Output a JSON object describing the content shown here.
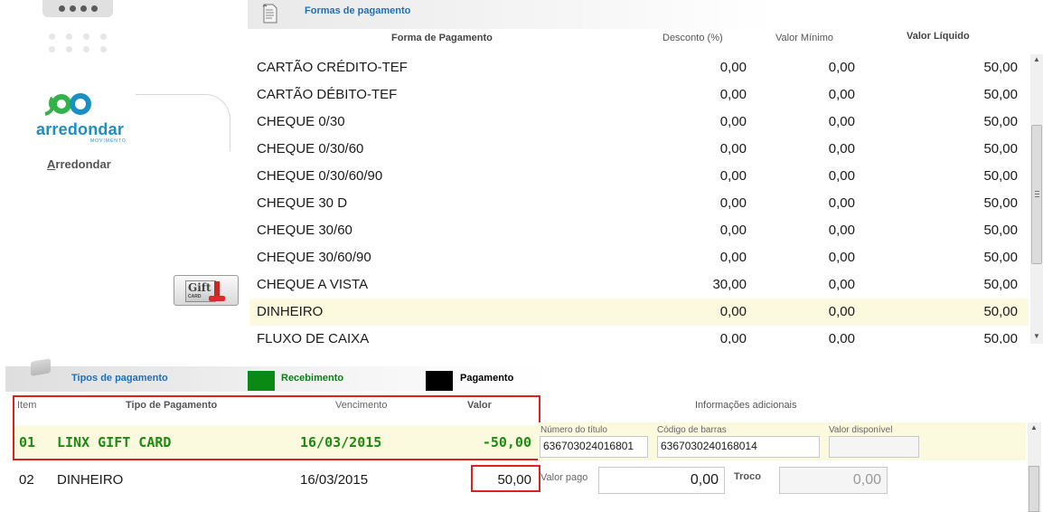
{
  "sidebar": {
    "logo_text": "arredondar",
    "logo_subtext": "MOVIMENTO",
    "arredondar_label_first": "A",
    "arredondar_label_rest": "rredondar",
    "gift_card_text": "Gift",
    "gift_card_subtext": "CARD"
  },
  "formas": {
    "title": "Formas de pagamento",
    "headers": {
      "forma": "Forma de Pagamento",
      "desconto": "Desconto (%)",
      "valor_minimo": "Valor Mínimo",
      "valor_liquido": "Valor Líquido"
    },
    "rows": [
      {
        "name": "CARTÃO CRÉDITO-TEF",
        "desconto": "0,00",
        "minimo": "0,00",
        "liquido": "50,00"
      },
      {
        "name": "CARTÃO DÉBITO-TEF",
        "desconto": "0,00",
        "minimo": "0,00",
        "liquido": "50,00"
      },
      {
        "name": "CHEQUE 0/30",
        "desconto": "0,00",
        "minimo": "0,00",
        "liquido": "50,00"
      },
      {
        "name": "CHEQUE 0/30/60",
        "desconto": "0,00",
        "minimo": "0,00",
        "liquido": "50,00"
      },
      {
        "name": "CHEQUE 0/30/60/90",
        "desconto": "0,00",
        "minimo": "0,00",
        "liquido": "50,00"
      },
      {
        "name": "CHEQUE 30 D",
        "desconto": "0,00",
        "minimo": "0,00",
        "liquido": "50,00"
      },
      {
        "name": "CHEQUE 30/60",
        "desconto": "0,00",
        "minimo": "0,00",
        "liquido": "50,00"
      },
      {
        "name": "CHEQUE 30/60/90",
        "desconto": "0,00",
        "minimo": "0,00",
        "liquido": "50,00"
      },
      {
        "name": "CHEQUE A VISTA",
        "desconto": "30,00",
        "minimo": "0,00",
        "liquido": "50,00"
      },
      {
        "name": "DINHEIRO",
        "desconto": "0,00",
        "minimo": "0,00",
        "liquido": "50,00"
      },
      {
        "name": "FLUXO DE CAIXA",
        "desconto": "0,00",
        "minimo": "0,00",
        "liquido": "50,00"
      }
    ]
  },
  "tabs": {
    "tipos": "Tipos de pagamento",
    "recebimento": "Recebimento",
    "pagamento": "Pagamento"
  },
  "items": {
    "headers": {
      "item": "Item",
      "tipo": "Tipo de Pagamento",
      "vencimento": "Vencimento",
      "valor": "Valor"
    },
    "rows": [
      {
        "item": "01",
        "tipo": "LINX GIFT CARD",
        "vencimento": "16/03/2015",
        "valor": "-50,00"
      },
      {
        "item": "02",
        "tipo": "DINHEIRO",
        "vencimento": "16/03/2015",
        "valor": "50,00"
      }
    ]
  },
  "info": {
    "title": "Informações adicionais",
    "numero_titulo_label": "Número do título",
    "numero_titulo_value": "636703024016801",
    "codigo_barras_label": "Código de barras",
    "codigo_barras_value": "6367030240168014",
    "valor_disponivel_label": "Valor disponível",
    "valor_disponivel_value": "",
    "valor_pago_label": "Valor pago",
    "valor_pago_value": "0,00",
    "troco_label": "Troco",
    "troco_value": "0,00"
  },
  "colors": {
    "accent_blue": "#1f6fb6",
    "recebimento_green": "#0a8a14",
    "pagamento_black": "#000000",
    "highlight_red": "#e01f1f",
    "selected_row": "#fbf9de"
  }
}
